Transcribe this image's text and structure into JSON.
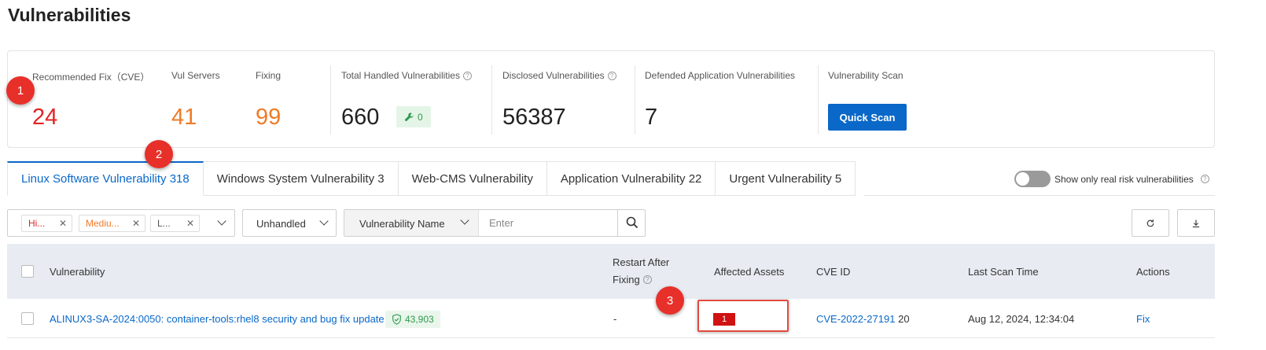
{
  "page_title": "Vulnerabilities",
  "stats": {
    "recommended_fix_label": "Recommended Fix（CVE）",
    "recommended_fix_value": "24",
    "vul_servers_label": "Vul Servers",
    "vul_servers_value": "41",
    "fixing_label": "Fixing",
    "fixing_value": "99",
    "total_handled_label": "Total Handled Vulnerabilities",
    "total_handled_value": "660",
    "total_handled_badge": "0",
    "disclosed_label": "Disclosed Vulnerabilities",
    "disclosed_value": "56387",
    "defended_label": "Defended Application Vulnerabilities",
    "defended_value": "7",
    "scan_label": "Vulnerability Scan",
    "quick_scan_button": "Quick Scan"
  },
  "markers": [
    "1",
    "2",
    "3"
  ],
  "tabs": [
    {
      "label": "Linux Software Vulnerability 318",
      "active": true
    },
    {
      "label": "Windows System Vulnerability 3",
      "active": false
    },
    {
      "label": "Web-CMS Vulnerability",
      "active": false
    },
    {
      "label": "Application Vulnerability 22",
      "active": false
    },
    {
      "label": "Urgent Vulnerability 5",
      "active": false
    }
  ],
  "real_risk_toggle": {
    "label": "Show only real risk vulnerabilities",
    "on": false
  },
  "filters": {
    "severity_chips": [
      {
        "label": "Hi...",
        "color": "#e02424"
      },
      {
        "label": "Mediu...",
        "color": "#ef7b27"
      },
      {
        "label": "L...",
        "color": "#555555"
      }
    ],
    "status_value": "Unhandled",
    "search_type": "Vulnerability Name",
    "search_placeholder": "Enter"
  },
  "table": {
    "headers": {
      "vulnerability": "Vulnerability",
      "restart_line1": "Restart After",
      "restart_line2": "Fixing",
      "affected_assets": "Affected Assets",
      "cve_id": "CVE ID",
      "last_scan_time": "Last Scan Time",
      "actions": "Actions"
    },
    "rows": [
      {
        "vulnerability": "ALINUX3-SA-2024:0050: container-tools:rhel8 security and bug fix update",
        "shield_count": "43,903",
        "restart": "-",
        "affected_assets": "1",
        "cve_id": "CVE-2022-27191",
        "cve_extra": "20",
        "last_scan_time": "Aug 12, 2024, 12:34:04",
        "action": "Fix"
      }
    ]
  },
  "colors": {
    "accent": "#0a68c8",
    "danger": "#e02424",
    "warning": "#ef7b27",
    "success": "#2e9a4b"
  }
}
